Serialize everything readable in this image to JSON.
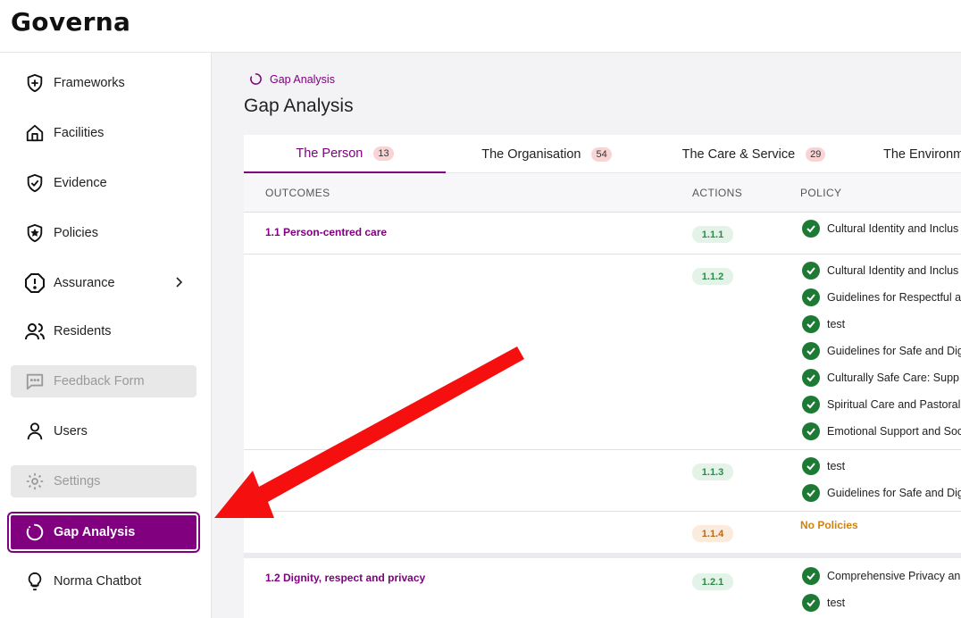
{
  "app": {
    "logo_text": "Governa"
  },
  "sidebar": {
    "items": [
      {
        "label": "Frameworks",
        "icon": "shield-plus-icon",
        "state": "normal"
      },
      {
        "label": "Facilities",
        "icon": "home-icon",
        "state": "normal"
      },
      {
        "label": "Evidence",
        "icon": "shield-check-icon",
        "state": "normal"
      },
      {
        "label": "Policies",
        "icon": "shield-star-icon",
        "state": "normal"
      },
      {
        "label": "Assurance",
        "icon": "alert-octagon-icon",
        "state": "normal",
        "has_submenu": true
      },
      {
        "label": "Residents",
        "icon": "users-icon",
        "state": "normal"
      },
      {
        "label": "Feedback Form",
        "icon": "message-icon",
        "state": "disabled"
      },
      {
        "label": "Users",
        "icon": "user-icon",
        "state": "normal"
      },
      {
        "label": "Settings",
        "icon": "gear-icon",
        "state": "disabled"
      },
      {
        "label": "Gap Analysis",
        "icon": "loader-circle-icon",
        "state": "active"
      },
      {
        "label": "Norma Chatbot",
        "icon": "lightbulb-icon",
        "state": "normal"
      }
    ]
  },
  "breadcrumb": {
    "label": "Gap Analysis"
  },
  "page": {
    "title": "Gap Analysis"
  },
  "tabs": [
    {
      "label": "The Person",
      "count": "13",
      "active": true
    },
    {
      "label": "The Organisation",
      "count": "54",
      "active": false
    },
    {
      "label": "The Care & Service",
      "count": "29",
      "active": false
    },
    {
      "label": "The Environm",
      "count": "",
      "active": false
    }
  ],
  "table": {
    "headers": {
      "outcomes": "OUTCOMES",
      "actions": "ACTIONS",
      "policy": "POLICY"
    },
    "rows": [
      {
        "outcome": "1.1 Person-centred care",
        "action": "1.1.1",
        "status": "ok",
        "policies": [
          "Cultural Identity and Inclus"
        ]
      },
      {
        "outcome": "",
        "action": "1.1.2",
        "status": "ok",
        "policies": [
          "Cultural Identity and Inclus",
          "Guidelines for Respectful a",
          "test",
          "Guidelines for Safe and Dig",
          "Culturally Safe Care: Supp",
          "Spiritual Care and Pastoral",
          "Emotional Support and Soc"
        ]
      },
      {
        "outcome": "",
        "action": "1.1.3",
        "status": "ok",
        "policies": [
          "test",
          "Guidelines for Safe and Dig"
        ]
      },
      {
        "outcome": "",
        "action": "1.1.4",
        "status": "warn",
        "no_policies_text": "No Policies",
        "policies": []
      },
      {
        "outcome": "1.2 Dignity, respect and privacy",
        "action": "1.2.1",
        "status": "ok",
        "policies": [
          "Comprehensive Privacy an",
          "test"
        ]
      }
    ]
  },
  "colors": {
    "brand": "#800080",
    "check": "#1d7a35",
    "annotation_arrow": "#f50f0f"
  }
}
